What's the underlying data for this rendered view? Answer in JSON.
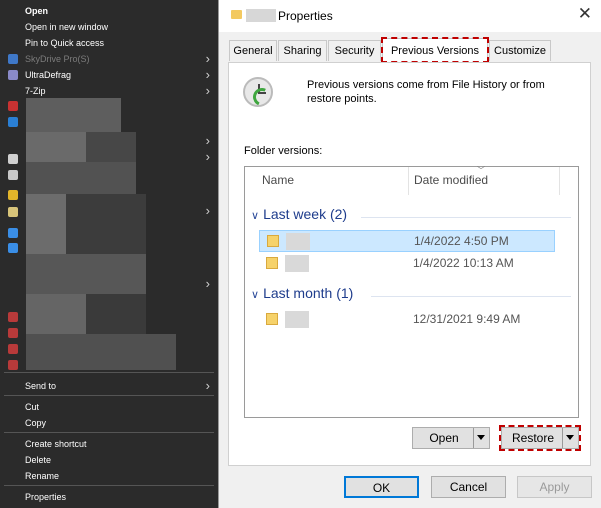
{
  "context_menu": {
    "items": [
      {
        "label": "Open",
        "bold": true
      },
      {
        "label": "Open in new window"
      },
      {
        "label": "Pin to Quick access"
      },
      {
        "label": "SkyDrive Pro(S)",
        "dim": true,
        "submenu": true
      },
      {
        "label": "UltraDefrag",
        "submenu": true
      },
      {
        "label": "7-Zip",
        "submenu": true
      }
    ],
    "bottom_items": {
      "send_to": "Send to",
      "cut": "Cut",
      "copy": "Copy",
      "create_shortcut": "Create shortcut",
      "delete": "Delete",
      "rename": "Rename",
      "properties": "Properties"
    }
  },
  "dialog": {
    "title": "Properties",
    "tabs": [
      "General",
      "Sharing",
      "Security",
      "Previous Versions",
      "Customize"
    ],
    "active_tab": "Previous Versions",
    "info_text": "Previous versions come from File History or from restore points.",
    "folder_versions_label": "Folder versions:",
    "columns": {
      "name": "Name",
      "date_modified": "Date modified"
    },
    "groups": [
      {
        "label": "Last week (2)",
        "rows": [
          {
            "date": "1/4/2022 4:50 PM",
            "selected": true
          },
          {
            "date": "1/4/2022 10:13 AM",
            "selected": false
          }
        ]
      },
      {
        "label": "Last month (1)",
        "rows": [
          {
            "date": "12/31/2021 9:49 AM",
            "selected": false
          }
        ]
      }
    ],
    "buttons": {
      "open": "Open",
      "restore": "Restore",
      "ok": "OK",
      "cancel": "Cancel",
      "apply": "Apply"
    }
  },
  "colors": {
    "menu_bg": "#2b2b2b",
    "highlight": "#c00000",
    "selection": "#cce8ff",
    "group_text": "#1e3c8c"
  }
}
